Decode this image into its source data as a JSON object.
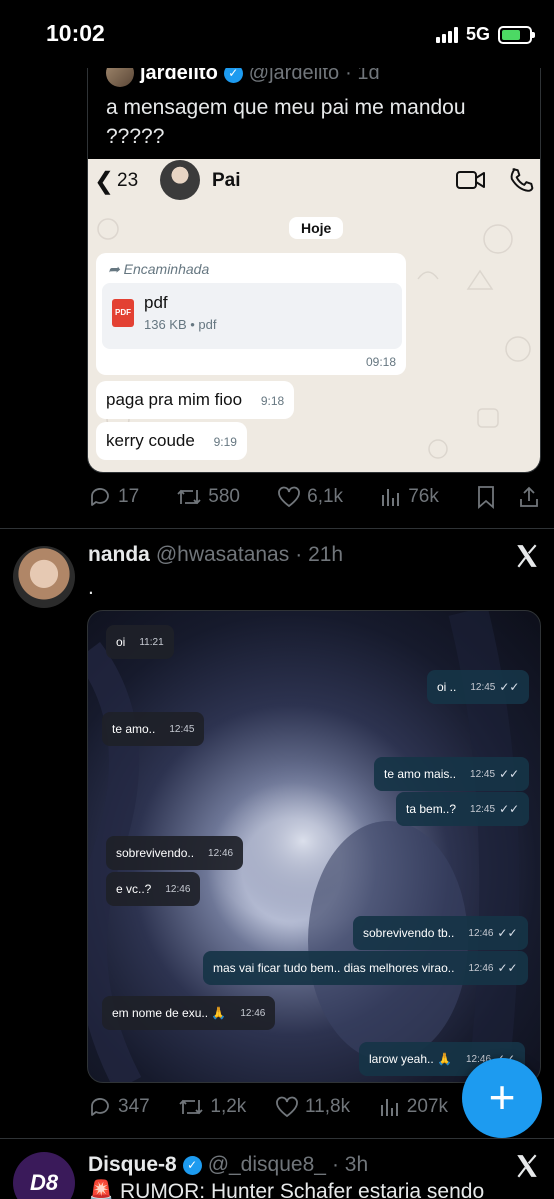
{
  "status_bar": {
    "time": "10:02",
    "network": "5G"
  },
  "quoted_tweet": {
    "name": "jardelito",
    "handle": "@jardelito",
    "age": "· 1d",
    "text": "a mensagem que meu pai me mandou ?????",
    "whatsapp": {
      "unread_count": "23",
      "contact_name": "Pai",
      "date_chip": "Hoje",
      "forwarded_label": "Encaminhada",
      "file_icon": "PDF",
      "file_name": "pdf",
      "file_meta": "136 KB • pdf",
      "forward_time": "09:18",
      "messages": [
        {
          "text": "paga pra mim fioo",
          "time": "9:18"
        },
        {
          "text": "kerry coude",
          "time": "9:19"
        }
      ]
    },
    "stats": {
      "replies": "17",
      "reposts": "580",
      "likes": "6,1k",
      "views": "76k"
    }
  },
  "tweet": {
    "name": "nanda",
    "handle": "@hwasatanas",
    "age": "· 21h",
    "text": ".",
    "chat": [
      {
        "dir": "in",
        "text": "oi",
        "time": "11:21"
      },
      {
        "dir": "out",
        "text": "oi ..",
        "time": "12:45",
        "ticks": "✓✓"
      },
      {
        "dir": "in",
        "text": "te amo..",
        "time": "12:45"
      },
      {
        "dir": "out",
        "text": "te amo mais..",
        "time": "12:45",
        "ticks": "✓✓"
      },
      {
        "dir": "out",
        "text": "ta bem..?",
        "time": "12:45",
        "ticks": "✓✓"
      },
      {
        "dir": "in",
        "text": "sobrevivendo..",
        "time": "12:46"
      },
      {
        "dir": "in",
        "text": "e vc..?",
        "time": "12:46"
      },
      {
        "dir": "out",
        "text": "sobrevivendo tb..",
        "time": "12:46",
        "ticks": "✓✓"
      },
      {
        "dir": "out",
        "text": "mas vai ficar tudo bem.. dias melhores virao..",
        "time": "12:46",
        "ticks": "✓✓"
      },
      {
        "dir": "in",
        "text": "em nome de exu.. 🙏",
        "time": "12:46"
      },
      {
        "dir": "out",
        "text": "larow yeah.. 🙏",
        "time": "12:46",
        "ticks": "✓✓"
      }
    ],
    "stats": {
      "replies": "347",
      "reposts": "1,2k",
      "likes": "11,8k",
      "views": "207k"
    }
  },
  "next_tweet": {
    "name": "Disque-8",
    "handle": "@_disque8_",
    "age": "· 3h",
    "avatar_text": "D8",
    "text": "🚨 RUMOR: Hunter Schafer estaria sendo"
  },
  "fab_label": "+"
}
